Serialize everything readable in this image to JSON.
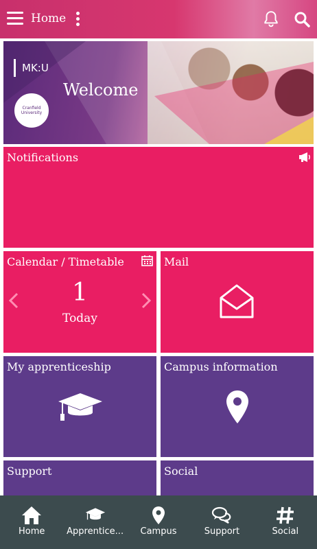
{
  "topbar": {
    "title": "Home",
    "icons": [
      "menu-icon",
      "more-vert-icon",
      "bell-icon",
      "search-icon"
    ]
  },
  "banner": {
    "brand": "MK:U",
    "welcome": "Welcome",
    "logo_text_1": "Cranfield",
    "logo_text_2": "University"
  },
  "tiles": {
    "notifications": {
      "label": "Notifications",
      "icon": "megaphone-icon",
      "color": "#e91e63"
    },
    "calendar": {
      "label": "Calendar / Timetable",
      "count": "1",
      "sub": "Today",
      "icon": "calendar-icon",
      "color": "#e91e63"
    },
    "mail": {
      "label": "Mail",
      "icon": "envelope-open-icon",
      "color": "#e91e63"
    },
    "apprenticeship": {
      "label": "My apprenticeship",
      "icon": "graduation-cap-icon",
      "color": "#5d3b8a"
    },
    "campus": {
      "label": "Campus information",
      "icon": "map-pin-icon",
      "color": "#5d3b8a"
    },
    "support": {
      "label": "Support",
      "color": "#5d3b8a"
    },
    "social": {
      "label": "Social",
      "color": "#5d3b8a"
    }
  },
  "bottom_nav": {
    "background": "#3c4b4e",
    "items": [
      {
        "label": "Home",
        "icon": "home-icon"
      },
      {
        "label": "Apprentice...",
        "icon": "graduation-cap-icon"
      },
      {
        "label": "Campus",
        "icon": "map-pin-icon"
      },
      {
        "label": "Support",
        "icon": "chat-bubbles-icon"
      },
      {
        "label": "Social",
        "icon": "hashtag-icon"
      }
    ]
  }
}
